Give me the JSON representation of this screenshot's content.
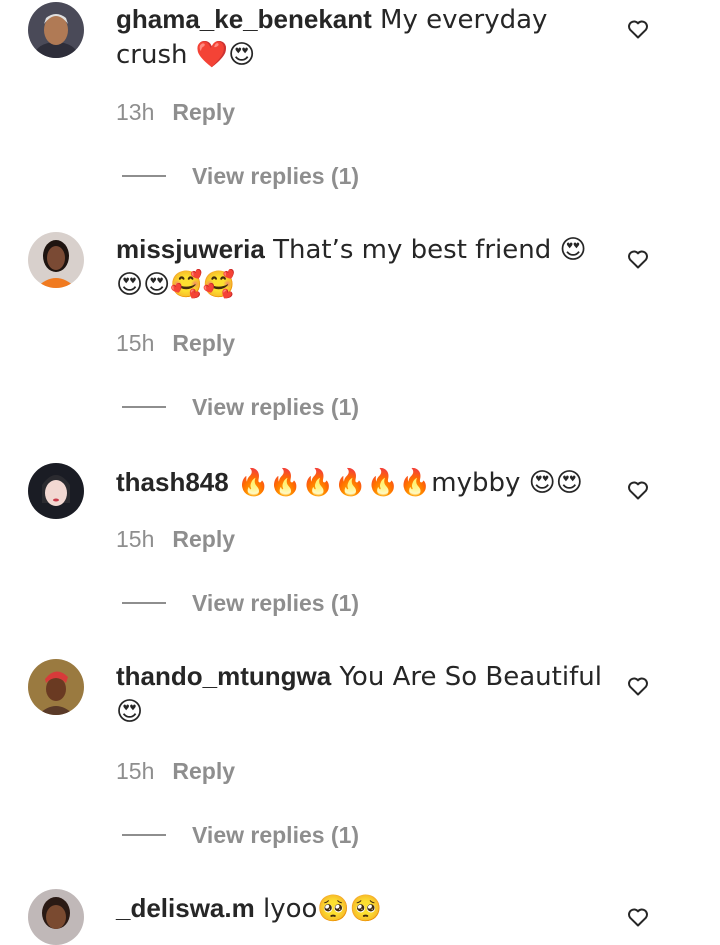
{
  "comments": [
    {
      "username": "ghama_ke_benekant",
      "text": " My everyday crush ❤️😍",
      "time": "13h",
      "reply_label": "Reply",
      "view_replies": "View replies (1)",
      "avatar": {
        "bg": "#4a4a58",
        "face": "#b07a55",
        "hair": "#e0e0e0"
      }
    },
    {
      "username": "missjuweria",
      "text": " That’s my best friend 😍😍😍🥰🥰",
      "time": "15h",
      "reply_label": "Reply",
      "view_replies": "View replies (1)",
      "avatar": {
        "bg": "#d8d0cc",
        "face": "#7a4a34",
        "hair": "#1e1410",
        "shirt": "#f07a20"
      }
    },
    {
      "username": "thash848",
      "text": " 🔥🔥🔥🔥🔥🔥mybby 😍😍",
      "time": "15h",
      "reply_label": "Reply",
      "view_replies": "View replies (1)",
      "avatar": {
        "bg": "#1a1c24",
        "face": "#f2d8d2",
        "hair": "#2b2b30"
      }
    },
    {
      "username": "thando_mtungwa",
      "text": " You Are So Beautiful 😍",
      "time": "15h",
      "reply_label": "Reply",
      "view_replies": "View replies (1)",
      "avatar": {
        "bg": "#9a7a40",
        "face": "#6a3a22",
        "hair": "#d83a3a"
      }
    },
    {
      "username": "_deliswa.m",
      "text": " lyoo🥺🥺",
      "avatar": {
        "bg": "#c0b8b8",
        "face": "#7a4a30",
        "hair": "#2a1a14"
      }
    }
  ],
  "icons": {
    "like": "heart-outline-icon"
  },
  "colors": {
    "text": "#262626",
    "muted": "#8e8e8e"
  }
}
